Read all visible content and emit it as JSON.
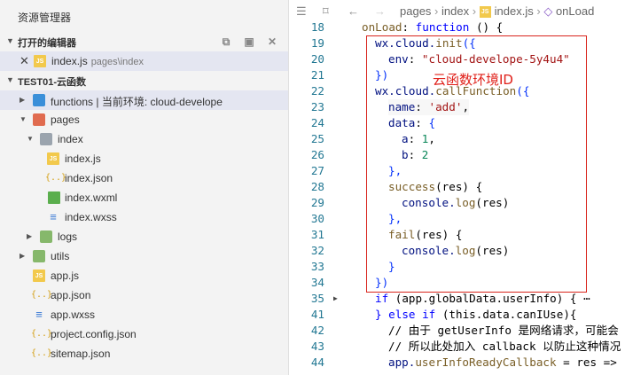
{
  "sidebar": {
    "title": "资源管理器",
    "open_editors": {
      "label": "打开的编辑器",
      "files": [
        {
          "name": "index.js",
          "path": "pages\\index"
        }
      ]
    },
    "project": {
      "label": "TEST01-云函数",
      "tree": [
        {
          "label": "functions | 当前环境: cloud-develope"
        },
        {
          "label": "pages"
        },
        {
          "label": "index"
        },
        {
          "label": "index.js"
        },
        {
          "label": "index.json"
        },
        {
          "label": "index.wxml"
        },
        {
          "label": "index.wxss"
        },
        {
          "label": "logs"
        },
        {
          "label": "utils"
        },
        {
          "label": "app.js"
        },
        {
          "label": "app.json"
        },
        {
          "label": "app.wxss"
        },
        {
          "label": "project.config.json"
        },
        {
          "label": "sitemap.json"
        }
      ]
    }
  },
  "editor": {
    "breadcrumb": [
      "pages",
      "index",
      "index.js",
      "onLoad"
    ],
    "annotation": "云函数环境ID",
    "code": {
      "line_numbers": [
        "18",
        "19",
        "20",
        "21",
        "22",
        "23",
        "24",
        "25",
        "26",
        "27",
        "28",
        "29",
        "30",
        "31",
        "32",
        "33",
        "34",
        "35",
        "41",
        "42",
        "43",
        "44"
      ],
      "l18": [
        "onLoad",
        "function",
        "() {"
      ],
      "l19": [
        "wx.cloud.",
        "init",
        "({"
      ],
      "l20": [
        "env",
        "\"cloud-develope-5y4u4\""
      ],
      "l21": [
        "})"
      ],
      "l22": [
        "wx.cloud.",
        "callFunction",
        "({"
      ],
      "l23": [
        "name",
        "'add'"
      ],
      "l24": [
        "data",
        "{"
      ],
      "l25": [
        "a",
        "1"
      ],
      "l26": [
        "b",
        "2"
      ],
      "l27": [
        "},"
      ],
      "l28": [
        "success",
        "(res) {"
      ],
      "l29": [
        "console.",
        "log",
        "(res)"
      ],
      "l30": [
        "},"
      ],
      "l31": [
        "fail",
        "(res) {"
      ],
      "l32": [
        "console.",
        "log",
        "(res)"
      ],
      "l33": [
        "}"
      ],
      "l34": [
        "})"
      ],
      "l35": [
        "if",
        "(app.globalData.userInfo) { ⋯"
      ],
      "l41": [
        "} else if",
        "(this.data.canIUse){"
      ],
      "l42": "// 由于 getUserInfo 是网络请求，可能会",
      "l43": "// 所以此处加入 callback 以防止这种情况",
      "l44": [
        "app.",
        "userInfoReadyCallback",
        " = res =>"
      ]
    }
  },
  "icons": {
    "explorer": [
      "close-icon",
      "js-file-icon",
      "json-file-icon",
      "wxml-file-icon",
      "wxss-file-icon",
      "folder-icon",
      "chevron-right-icon",
      "chevron-down-icon"
    ],
    "toolbar": [
      "new-file-icon",
      "save-all-icon",
      "close-all-icon"
    ],
    "editor": [
      "list-icon",
      "bookmark-icon",
      "back-icon",
      "forward-icon",
      "method-cube-icon"
    ]
  },
  "colors": {
    "annotation_red": "#d9251d",
    "keyword_blue": "#0000ff",
    "string_red": "#a31515",
    "number_green": "#098658",
    "comment_green": "#008000"
  }
}
